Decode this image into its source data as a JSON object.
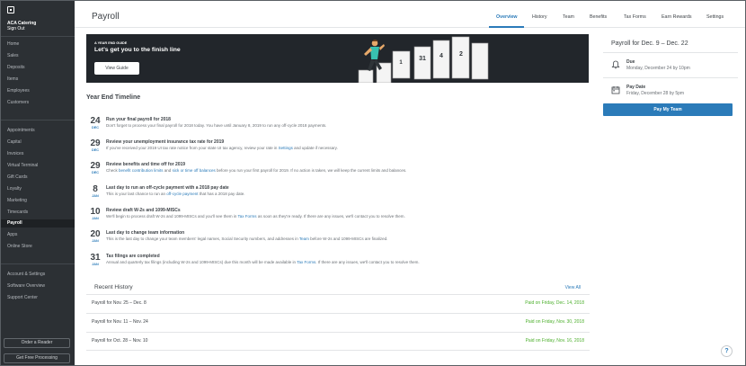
{
  "sidebar": {
    "business_name": "ACA Catering",
    "sign_out": "Sign Out",
    "group1": [
      "Home",
      "Sales",
      "Deposits",
      "Items",
      "Employees",
      "Customers"
    ],
    "group2": [
      "Appointments",
      "Capital",
      "Invoices",
      "Virtual Terminal",
      "Gift Cards",
      "Loyalty",
      "Marketing",
      "Timecards",
      "Payroll",
      "Apps",
      "Online Store"
    ],
    "active": "Payroll",
    "group3": [
      "Account & Settings",
      "Software Overview",
      "Support Center"
    ],
    "order_reader": "Order a Reader",
    "free_processing": "Get Free Processing"
  },
  "header": {
    "title": "Payroll",
    "tabs": [
      "Overview",
      "History",
      "Team",
      "Benefits",
      "Tax Forms",
      "Earn Rewards",
      "Settings"
    ],
    "active_tab": "Overview"
  },
  "banner": {
    "eyebrow": "A YEAR END GUIDE",
    "headline": "Let's get you to the finish line",
    "button": "View Guide",
    "calendar_digits": [
      "1",
      "31",
      "4",
      "2"
    ]
  },
  "timeline": {
    "title": "Year End Timeline",
    "items": [
      {
        "day": "24",
        "month": "DEC",
        "title": "Run your final payroll for 2018",
        "desc": "Don't forget to process your final payroll for 2018 today. You have until January 8, 2019 to run any off-cycle 2018 payments."
      },
      {
        "day": "29",
        "month": "DEC",
        "title": "Review your unemployment insurance tax rate for 2019",
        "desc_pre": "If you've received your 2019 UI tax rate notice from your state UI tax agency, review your rate in ",
        "link": "Settings",
        "desc_post": " and update if necessary."
      },
      {
        "day": "29",
        "month": "DEC",
        "title": "Review benefits and time off for 2019",
        "desc_pre": "Check ",
        "link": "benefit contribution limits",
        "desc_mid": " and ",
        "link2": "sick or time off balances",
        "desc_post": " before you run your first payroll for 2019. If no action is taken, we will keep the current limits and balances."
      },
      {
        "day": "8",
        "month": "JAN",
        "title": "Last day to run an off-cycle payment with a 2018 pay date",
        "desc_pre": "This is your last chance to run an ",
        "link": "off-cycle payment",
        "desc_post": " that has a 2018 pay date."
      },
      {
        "day": "10",
        "month": "JAN",
        "title": "Review draft W-2s and 1099-MISCs",
        "desc_pre": "We'll begin to process draft W-2s and 1099-MISCs and you'll see them in ",
        "link": "Tax Forms",
        "desc_post": " as soon as they're ready. If there are any issues, we'll contact you to resolve them."
      },
      {
        "day": "20",
        "month": "JAN",
        "title": "Last day to change team information",
        "desc_pre": "This is the last day to change your team members' legal names, Social Security numbers, and addresses in ",
        "link": "Team",
        "desc_post": " before W-2s and 1099-MISCs are finalized."
      },
      {
        "day": "31",
        "month": "JAN",
        "title": "Tax filings are completed",
        "desc_pre": "Annual and quarterly tax filings (including W-2s and 1099-MISCs) due this month will be made available in ",
        "link": "Tax Forms",
        "desc_post": ". If there are any issues, we'll contact you to resolve them."
      }
    ]
  },
  "history": {
    "title": "Recent History",
    "view_all": "View All",
    "rows": [
      {
        "period": "Payroll for Nov. 25 – Dec. 8",
        "status": "Paid on Friday, Dec. 14, 2018"
      },
      {
        "period": "Payroll for Nov. 11 – Nov. 24",
        "status": "Paid on Friday, Nov. 30, 2018"
      },
      {
        "period": "Payroll for Oct. 28 – Nov. 10",
        "status": "Paid on Friday, Nov. 16, 2018"
      }
    ]
  },
  "panel": {
    "title": "Payroll for Dec. 9 – Dec. 22",
    "due_label": "Due",
    "due_value": "Monday, December 24 by 10pm",
    "pay_label": "Pay Date",
    "pay_value": "Friday, December 28 by 5pm",
    "button": "Pay My Team"
  },
  "help": "?",
  "colors": {
    "accent": "#2b7bb9",
    "sidebar": "#2c3034",
    "paid": "#4caf2c",
    "banner": "#22262b"
  },
  "icons": {
    "due": "bell-icon",
    "pay": "calendar-icon",
    "logo": "square-logo-icon",
    "help": "help-icon"
  }
}
